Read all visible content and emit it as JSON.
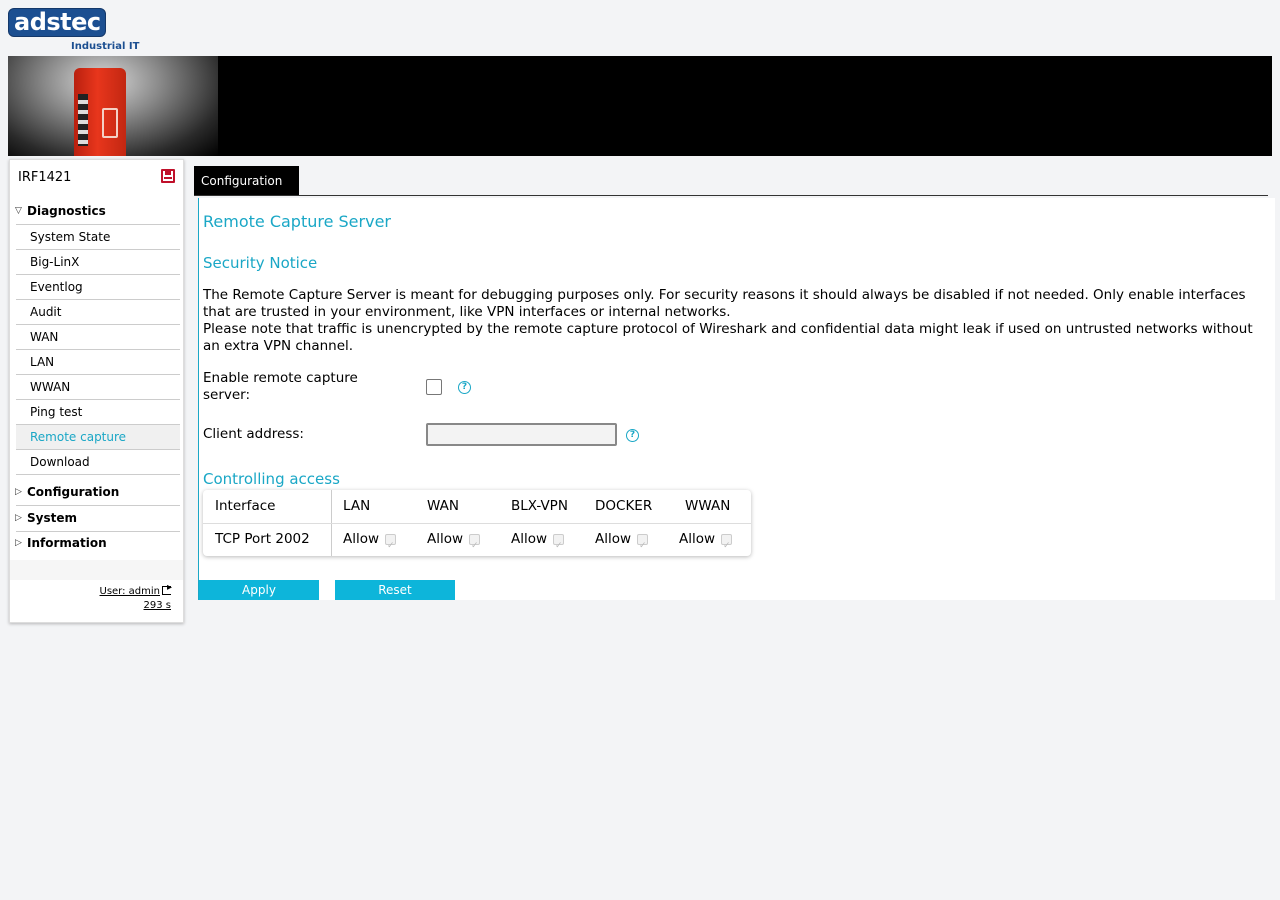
{
  "brand": {
    "logo_text": "adstec",
    "tagline": "Industrial IT"
  },
  "tabs": [
    {
      "label": "Configuration"
    }
  ],
  "sidebar": {
    "device_name": "IRF1421",
    "sections": [
      {
        "label": "Diagnostics",
        "expanded": true,
        "items": [
          {
            "label": "System State"
          },
          {
            "label": "Big-LinX"
          },
          {
            "label": "Eventlog"
          },
          {
            "label": "Audit"
          },
          {
            "label": "WAN"
          },
          {
            "label": "LAN"
          },
          {
            "label": "WWAN"
          },
          {
            "label": "Ping test"
          },
          {
            "label": "Remote capture",
            "active": true
          },
          {
            "label": "Download"
          }
        ]
      },
      {
        "label": "Configuration",
        "expanded": false
      },
      {
        "label": "System",
        "expanded": false
      },
      {
        "label": "Information",
        "expanded": false
      }
    ],
    "user_label": "User: admin",
    "session_timer": "293 s"
  },
  "main": {
    "title": "Remote Capture Server",
    "notice_heading": "Security Notice",
    "notice_line1": "The Remote Capture Server is meant for debugging purposes only. For security reasons it should always be disabled if not needed. Only enable interfaces that are trusted in your environment, like VPN interfaces or internal networks.",
    "notice_line2": "Please note that traffic is unencrypted by the remote capture protocol of Wireshark and confidential data might leak if used on untrusted networks without an extra VPN channel.",
    "enable_label": "Enable remote capture server:",
    "enable_checked": false,
    "client_label": "Client address:",
    "client_value": "",
    "access_heading": "Controlling access",
    "access_table": {
      "headers": [
        "Interface",
        "LAN",
        "WAN",
        "BLX-VPN",
        "DOCKER",
        "WWAN"
      ],
      "row_label": "TCP Port 2002",
      "cell_label": "Allow"
    },
    "apply_label": "Apply",
    "reset_label": "Reset"
  },
  "colors": {
    "accent": "#1aa7c6",
    "button": "#0db5da",
    "brand": "#1c4f91",
    "save_icon": "#c0102a"
  }
}
